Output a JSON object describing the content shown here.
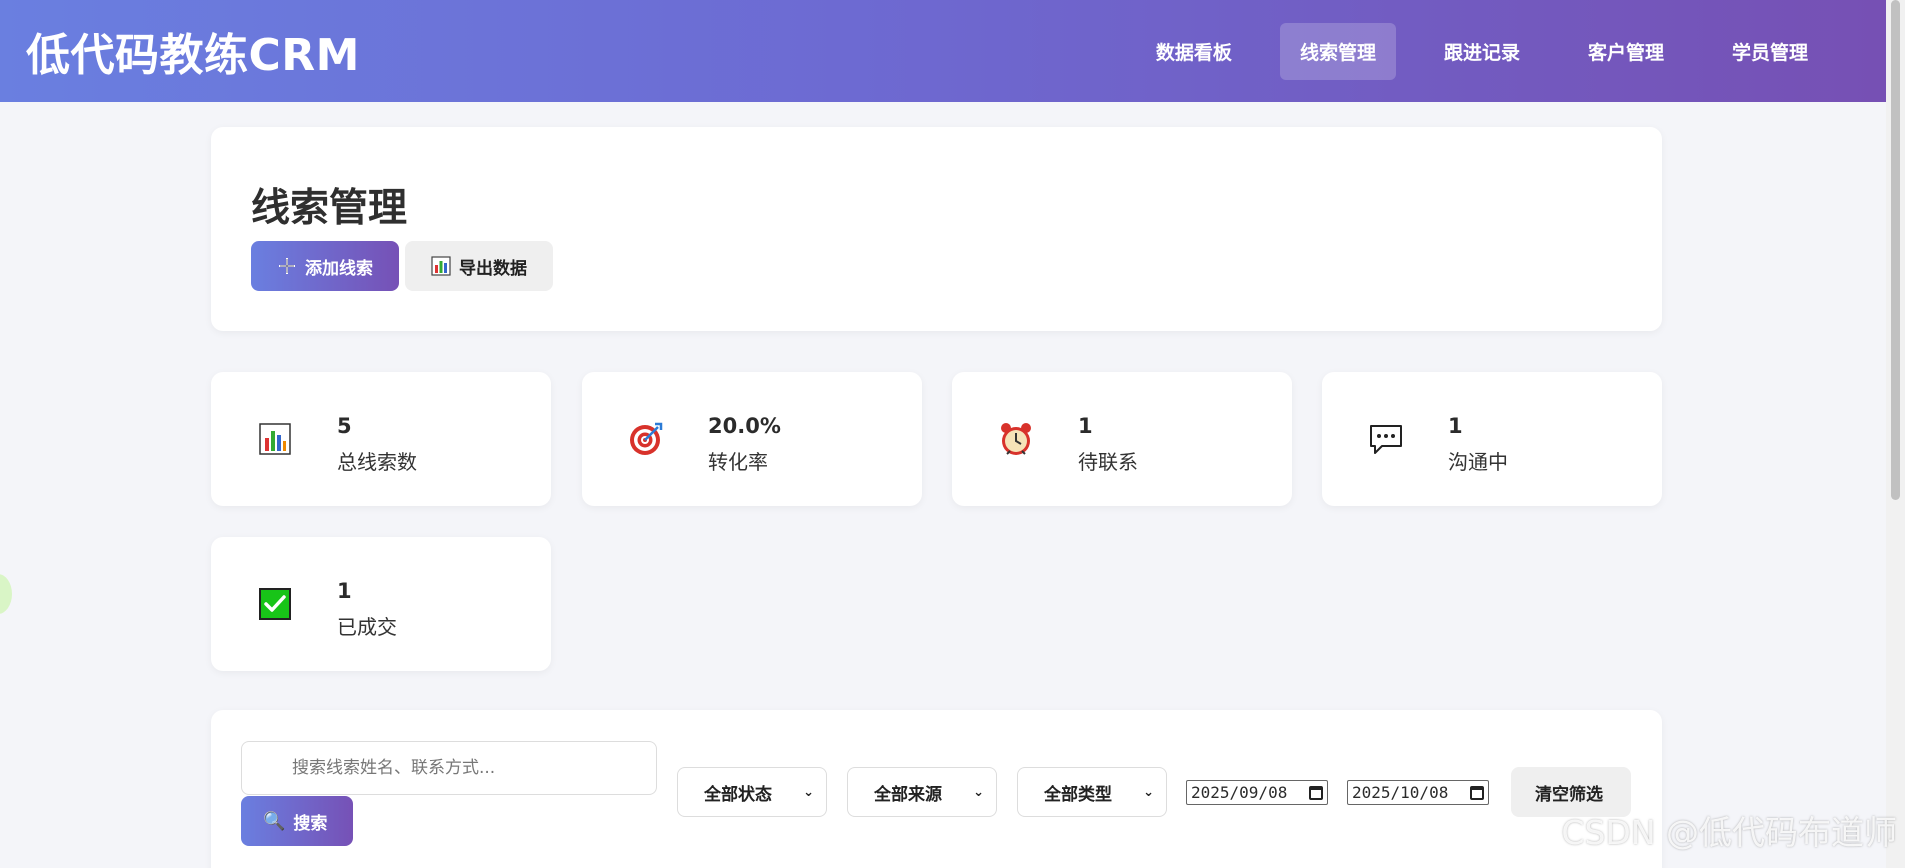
{
  "app": {
    "brand": "低代码教练CRM"
  },
  "nav": {
    "items": [
      {
        "label": "数据看板",
        "active": false
      },
      {
        "label": "线索管理",
        "active": true
      },
      {
        "label": "跟进记录",
        "active": false
      },
      {
        "label": "客户管理",
        "active": false
      },
      {
        "label": "学员管理",
        "active": false
      }
    ]
  },
  "header": {
    "title": "线索管理",
    "add_label": "添加线索",
    "export_label": "导出数据"
  },
  "stats": [
    {
      "value": "5",
      "label": "总线索数",
      "icon": "bar-chart-icon"
    },
    {
      "value": "20.0%",
      "label": "转化率",
      "icon": "target-icon"
    },
    {
      "value": "1",
      "label": "待联系",
      "icon": "alarm-clock-icon"
    },
    {
      "value": "1",
      "label": "沟通中",
      "icon": "speech-bubble-icon"
    },
    {
      "value": "1",
      "label": "已成交",
      "icon": "check-box-icon"
    }
  ],
  "filters": {
    "search_placeholder": "搜索线索姓名、联系方式...",
    "search_label": "搜索",
    "status": "全部状态",
    "source": "全部来源",
    "type": "全部类型",
    "date_from": "2025/09/08",
    "date_to": "2025/10/08",
    "clear_label": "清空筛选"
  },
  "watermark": "CSDN @低代码布道师",
  "colors": {
    "accent_start": "#6a7fe0",
    "accent_end": "#7651b6",
    "background": "#f4f5f9"
  }
}
